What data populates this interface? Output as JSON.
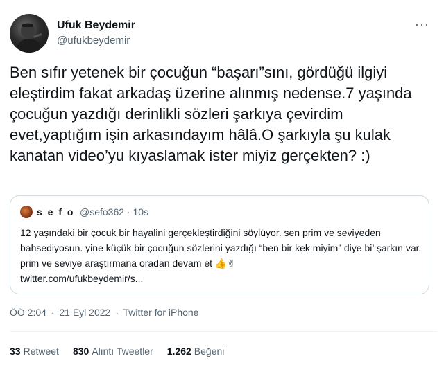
{
  "author": {
    "name": "Ufuk Beydemir",
    "handle": "@ufukbeydemir"
  },
  "more_glyph": "···",
  "tweet_text": "Ben sıfır yetenek bir çocuğun “başarı”sını, gördüğü ilgiyi eleştirdim fakat arkadaş üzerine alınmış nedense.7 yaşında çocuğun yazdığı derinlikli sözleri şarkıya çevirdim evet,yaptığım işin arkasındayım hâlâ.O şarkıyla şu kulak kanatan video’yu kıyaslamak ister miyiz gerçekten? :)",
  "quoted": {
    "name": "s e f o",
    "handle": "@sefo362 · 10s",
    "text": "12 yaşındaki bir çocuk bir hayalini gerçekleştirdiğini söylüyor. sen prim ve seviyeden bahsediyosun. yine küçük bir çocuğun sözlerini yazdığı “ben bir kek miyim” diye bi’ şarkın var. prim ve seviye araştırmana oradan devam et",
    "emojis": "👍✌",
    "link": "twitter.com/ufukbeydemir/s..."
  },
  "meta": {
    "time": "ÖÖ 2:04",
    "sep1": "·",
    "date": "21 Eyl 2022",
    "sep2": "·",
    "source": "Twitter for iPhone"
  },
  "stats": {
    "retweets_count": "33",
    "retweets_label": "Retweet",
    "quotes_count": "830",
    "quotes_label": "Alıntı Tweetler",
    "likes_count": "1.262",
    "likes_label": "Beğeni"
  },
  "colors": {
    "text": "#0f1419",
    "secondary": "#536471",
    "border": "#cfd9de"
  }
}
